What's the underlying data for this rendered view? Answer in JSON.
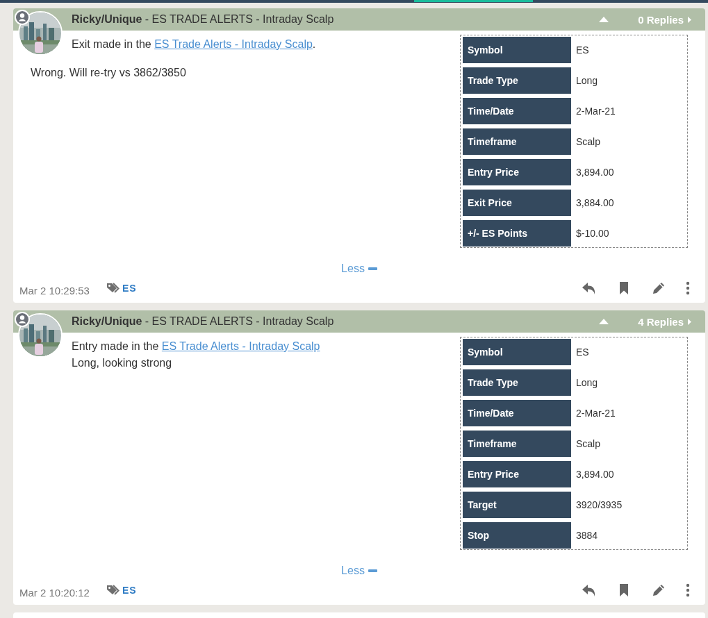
{
  "posts": [
    {
      "author": "Ricky/Unique",
      "channel": " - ES TRADE ALERTS - Intraday Scalp",
      "replies": "0 Replies",
      "intro": {
        "before": "Exit made in the ",
        "link": "ES Trade Alerts - Intraday Scalp",
        "after": "."
      },
      "lines": [
        {
          "kind": "full",
          "text": "Wrong. Will re-try vs 3862/3850"
        }
      ],
      "fields": [
        {
          "label": "Symbol",
          "value": "ES"
        },
        {
          "label": "Trade Type",
          "value": "Long"
        },
        {
          "label": "Time/Date",
          "value": "2-Mar-21"
        },
        {
          "label": "Timeframe",
          "value": "Scalp"
        },
        {
          "label": "Entry Price",
          "value": "3,894.00"
        },
        {
          "label": "Exit Price",
          "value": "3,884.00"
        },
        {
          "label": "+/- ES Points",
          "value": "$-10.00"
        }
      ],
      "less": "Less",
      "time": "Mar 2 10:29:53",
      "tag": "ES"
    },
    {
      "author": "Ricky/Unique",
      "channel": " - ES TRADE ALERTS - Intraday Scalp",
      "replies": "4 Replies",
      "intro": {
        "before": "Entry made in the ",
        "link": "ES Trade Alerts - Intraday Scalp"
      },
      "lines": [
        {
          "kind": "indented",
          "text": "Long, looking strong"
        }
      ],
      "fields": [
        {
          "label": "Symbol",
          "value": "ES"
        },
        {
          "label": "Trade Type",
          "value": "Long"
        },
        {
          "label": "Time/Date",
          "value": "2-Mar-21"
        },
        {
          "label": "Timeframe",
          "value": "Scalp"
        },
        {
          "label": "Entry Price",
          "value": "3,894.00"
        },
        {
          "label": "Target",
          "value": "3920/3935"
        },
        {
          "label": "Stop",
          "value": "3884"
        }
      ],
      "less": "Less",
      "time": "Mar 2 10:20:12",
      "tag": "ES"
    }
  ]
}
